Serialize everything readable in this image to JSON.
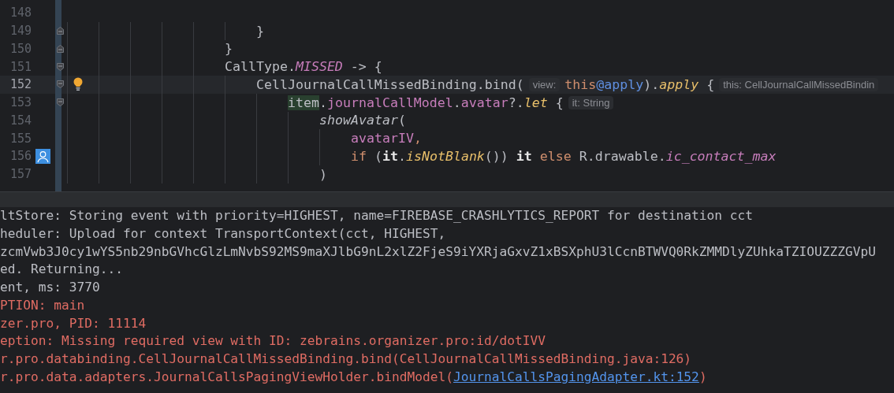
{
  "editor": {
    "lines": [
      {
        "number": "148",
        "current": false
      },
      {
        "number": "149",
        "current": false,
        "fold": {
          "kind": "end"
        },
        "segments": [
          {
            "kind": "code",
            "tokens": [
              {
                "t": "}",
                "kind": "plain"
              }
            ]
          }
        ]
      },
      {
        "number": "150",
        "current": false,
        "fold": {
          "kind": "end"
        },
        "segments": [
          {
            "kind": "code",
            "tokens": [
              {
                "t": "}",
                "kind": "plain"
              }
            ]
          }
        ]
      },
      {
        "number": "151",
        "current": false,
        "fold": {
          "kind": "start"
        },
        "segments": [
          {
            "kind": "code",
            "tokens": [
              {
                "t": "CallType.",
                "kind": "plain"
              },
              {
                "t": "MISSED",
                "kind": "const"
              },
              {
                "t": " -> {",
                "kind": "plain"
              }
            ]
          }
        ]
      },
      {
        "number": "152",
        "current": true,
        "fold": {
          "kind": "start"
        },
        "intention_bulb": true,
        "segments": [
          {
            "kind": "code",
            "tokens": [
              {
                "t": "CellJournalCallMissedBinding.bind(",
                "kind": "plain"
              }
            ]
          },
          {
            "kind": "hint",
            "text": "view:"
          },
          {
            "kind": "code",
            "tokens": [
              {
                "t": "this",
                "kind": "keyword"
              },
              {
                "t": "@apply",
                "kind": "label"
              },
              {
                "t": ").",
                "kind": "plain"
              },
              {
                "t": "apply",
                "kind": "ext"
              },
              {
                "t": " {",
                "kind": "plain"
              }
            ]
          },
          {
            "kind": "hint",
            "text": "this: CellJournalCallMissedBindin"
          }
        ]
      },
      {
        "number": "153",
        "current": false,
        "fold": {
          "kind": "start"
        },
        "segments": [
          {
            "kind": "code",
            "tokens": [
              {
                "t": "item",
                "kind": "highlight"
              },
              {
                "t": ".",
                "kind": "plain"
              },
              {
                "t": "journalCallModel",
                "kind": "field"
              },
              {
                "t": ".",
                "kind": "plain"
              },
              {
                "t": "avatar",
                "kind": "field"
              },
              {
                "t": "?.",
                "kind": "plain"
              },
              {
                "t": "let",
                "kind": "ext"
              },
              {
                "t": " {",
                "kind": "plain"
              }
            ]
          },
          {
            "kind": "hint",
            "text": "it: String"
          }
        ]
      },
      {
        "number": "154",
        "current": false,
        "segments": [
          {
            "kind": "code",
            "tokens": [
              {
                "t": "showAvatar",
                "kind": "italic"
              },
              {
                "t": "(",
                "kind": "plain"
              }
            ]
          }
        ]
      },
      {
        "number": "155",
        "current": false,
        "segments": [
          {
            "kind": "code",
            "tokens": [
              {
                "t": "avatarIV",
                "kind": "field"
              },
              {
                "t": ",",
                "kind": "keyword"
              }
            ]
          }
        ]
      },
      {
        "number": "156",
        "current": false,
        "gutter_icon": {
          "kind": "person"
        },
        "segments": [
          {
            "kind": "code",
            "tokens": [
              {
                "t": "if",
                "kind": "keyword"
              },
              {
                "t": " (",
                "kind": "plain"
              },
              {
                "t": "it",
                "kind": "bold"
              },
              {
                "t": ".",
                "kind": "plain"
              },
              {
                "t": "isNotBlank",
                "kind": "ext"
              },
              {
                "t": "()) ",
                "kind": "plain"
              },
              {
                "t": "it",
                "kind": "bold"
              },
              {
                "t": " else",
                "kind": "keyword"
              },
              {
                "t": " R.drawable.",
                "kind": "plain"
              },
              {
                "t": "ic_contact_max",
                "kind": "const"
              }
            ]
          }
        ]
      },
      {
        "number": "157",
        "current": false,
        "segments": [
          {
            "kind": "code",
            "tokens": [
              {
                "t": ")",
                "kind": "plain"
              }
            ]
          }
        ]
      }
    ]
  },
  "logcat": {
    "lines": [
      {
        "kind": "info",
        "parts": [
          {
            "kind": "text",
            "text": "ltStore: Storing event with priority=HIGHEST, name=FIREBASE_CRASHLYTICS_REPORT for destination cct"
          }
        ]
      },
      {
        "kind": "info",
        "parts": [
          {
            "kind": "text",
            "text": "heduler: Upload for context TransportContext(cct, HIGHEST,"
          }
        ]
      },
      {
        "kind": "info",
        "parts": [
          {
            "kind": "text",
            "text": "zcmVwb3J0cy1wYS5nb29nbGVhcGlzLmNvbS92MS9maXJlbG9nL2xlZ2FjeS9iYXRjaGxvZ1xBSXphU3lCcnBTWVQ0RkZMMDlyZUhkaTZIOUZZZGVpU"
          }
        ]
      },
      {
        "kind": "info",
        "parts": [
          {
            "kind": "text",
            "text": "ed. Returning..."
          }
        ]
      },
      {
        "kind": "info",
        "parts": [
          {
            "kind": "text",
            "text": "ent, ms: 3770"
          }
        ]
      },
      {
        "kind": "error",
        "parts": [
          {
            "kind": "text",
            "text": "PTION: main"
          }
        ]
      },
      {
        "kind": "error",
        "parts": [
          {
            "kind": "text",
            "text": "zer.pro, PID: 11114"
          }
        ]
      },
      {
        "kind": "error",
        "parts": [
          {
            "kind": "text",
            "text": "eption: Missing required view with ID: zebrains.organizer.pro:id/dotIVV"
          }
        ]
      },
      {
        "kind": "error",
        "parts": [
          {
            "kind": "text",
            "text": "r.pro.databinding.CellJournalCallMissedBinding.bind(CellJournalCallMissedBinding.java:126)"
          }
        ]
      },
      {
        "kind": "error",
        "parts": [
          {
            "kind": "text",
            "text": "r.pro.data.adapters.JournalCallsPagingViewHolder.bindModel("
          },
          {
            "kind": "link",
            "text": "JournalCallsPagingAdapter.kt:152"
          },
          {
            "kind": "text",
            "text": ")"
          }
        ]
      }
    ]
  }
}
